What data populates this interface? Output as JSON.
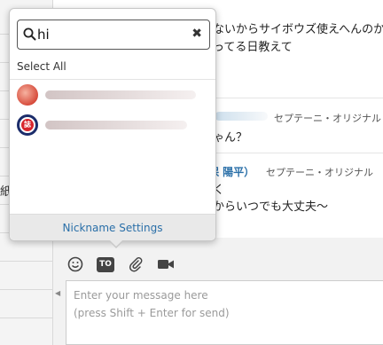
{
  "left_panel": {
    "partial_char": "紙"
  },
  "chat": {
    "lines": [
      {
        "text": "ないからサイボウズ使えへんのか"
      },
      {
        "text": "ってる日教えて"
      },
      {
        "text": "ゃん？"
      },
      {
        "text": "く"
      },
      {
        "text": "からいつでも大丈夫〜"
      }
    ],
    "message_meta": [
      {
        "name": "",
        "room": "セプテーニ・オリジナル"
      },
      {
        "name": "保 陽平）",
        "room": "セプテーニ・オリジナル"
      }
    ]
  },
  "mention_popup": {
    "search_value": "hi",
    "select_all_label": "Select All",
    "members": [
      {
        "avatar": "red-avatar"
      },
      {
        "avatar": "emblem-avatar",
        "avatar_text": "誌"
      }
    ],
    "footer_label": "Nickname Settings"
  },
  "composer": {
    "to_label": "TO",
    "placeholder": "Enter your message here\n(press Shift + Enter for send)"
  },
  "colors": {
    "accent": "#2a6fa8",
    "toolbar_icon": "#444444"
  }
}
